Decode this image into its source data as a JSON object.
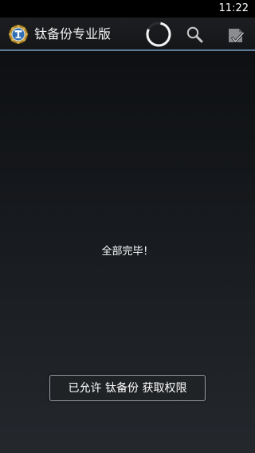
{
  "status_bar": {
    "time": "11:22"
  },
  "action_bar": {
    "title": "钛备份专业版",
    "icons": {
      "app": "titanium-backup-app-icon",
      "progress": "loading-spinner-icon",
      "search": "search-icon",
      "batch": "checklist-icon"
    },
    "accent_color": "#5a7c99"
  },
  "content": {
    "message": "全部完毕！"
  },
  "toast": {
    "text": "已允许 钛备份 获取权限"
  }
}
